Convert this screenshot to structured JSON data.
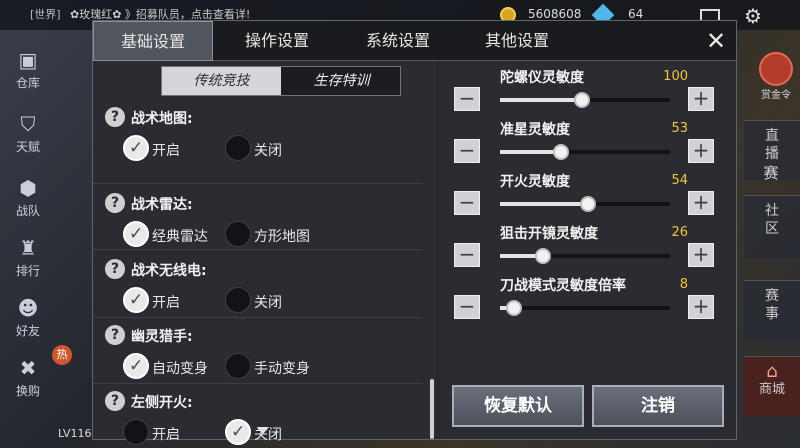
{
  "topbar": {
    "chat_tag": "[世界]",
    "chat_text": "✿玫瑰红✿ 》招募队员，点击查看详!",
    "coins": "5608608",
    "gems": "64"
  },
  "left_nav": [
    {
      "label": "仓库",
      "icon": "warehouse-icon"
    },
    {
      "label": "天赋",
      "icon": "talent-icon"
    },
    {
      "label": "战队",
      "icon": "team-icon"
    },
    {
      "label": "排行",
      "icon": "trophy-icon"
    },
    {
      "label": "好友",
      "icon": "friends-icon"
    },
    {
      "label": "换购",
      "icon": "tools-icon"
    }
  ],
  "hot_badge": "热",
  "level_text": "LV116",
  "right_side": {
    "reward_label": "赏金令",
    "live_label": "直播",
    "game_label": "赛",
    "community_label": "社区",
    "events_label": "赛事",
    "shop_label": "商城"
  },
  "panel": {
    "tabs": [
      "基础设置",
      "操作设置",
      "系统设置",
      "其他设置"
    ],
    "active_tab": 0,
    "close_glyph": "✕",
    "subtabs": [
      "传统竞技",
      "生存特训"
    ],
    "settings": [
      {
        "title": "战术地图:",
        "options": [
          "开启",
          "关闭"
        ],
        "selected": 0
      },
      {
        "title": "战术雷达:",
        "options": [
          "经典雷达",
          "方形地图"
        ],
        "selected": 0
      },
      {
        "title": "战术无线电:",
        "options": [
          "开启",
          "关闭"
        ],
        "selected": 0
      },
      {
        "title": "幽灵猎手:",
        "options": [
          "自动变身",
          "手动变身"
        ],
        "selected": 0
      },
      {
        "title": "左侧开火:",
        "options": [
          "开启",
          "关闭"
        ],
        "selected": 1
      }
    ],
    "sliders": [
      {
        "title": "陀螺仪灵敏度",
        "value": "100",
        "fraction": 0.48
      },
      {
        "title": "准星灵敏度",
        "value": "53",
        "fraction": 0.36
      },
      {
        "title": "开火灵敏度",
        "value": "54",
        "fraction": 0.52
      },
      {
        "title": "狙击开镜灵敏度",
        "value": "26",
        "fraction": 0.25
      },
      {
        "title": "刀战模式灵敏度倍率",
        "value": "8",
        "fraction": 0.08
      }
    ],
    "reset_button": "恢复默认",
    "logout_button": "注销"
  }
}
